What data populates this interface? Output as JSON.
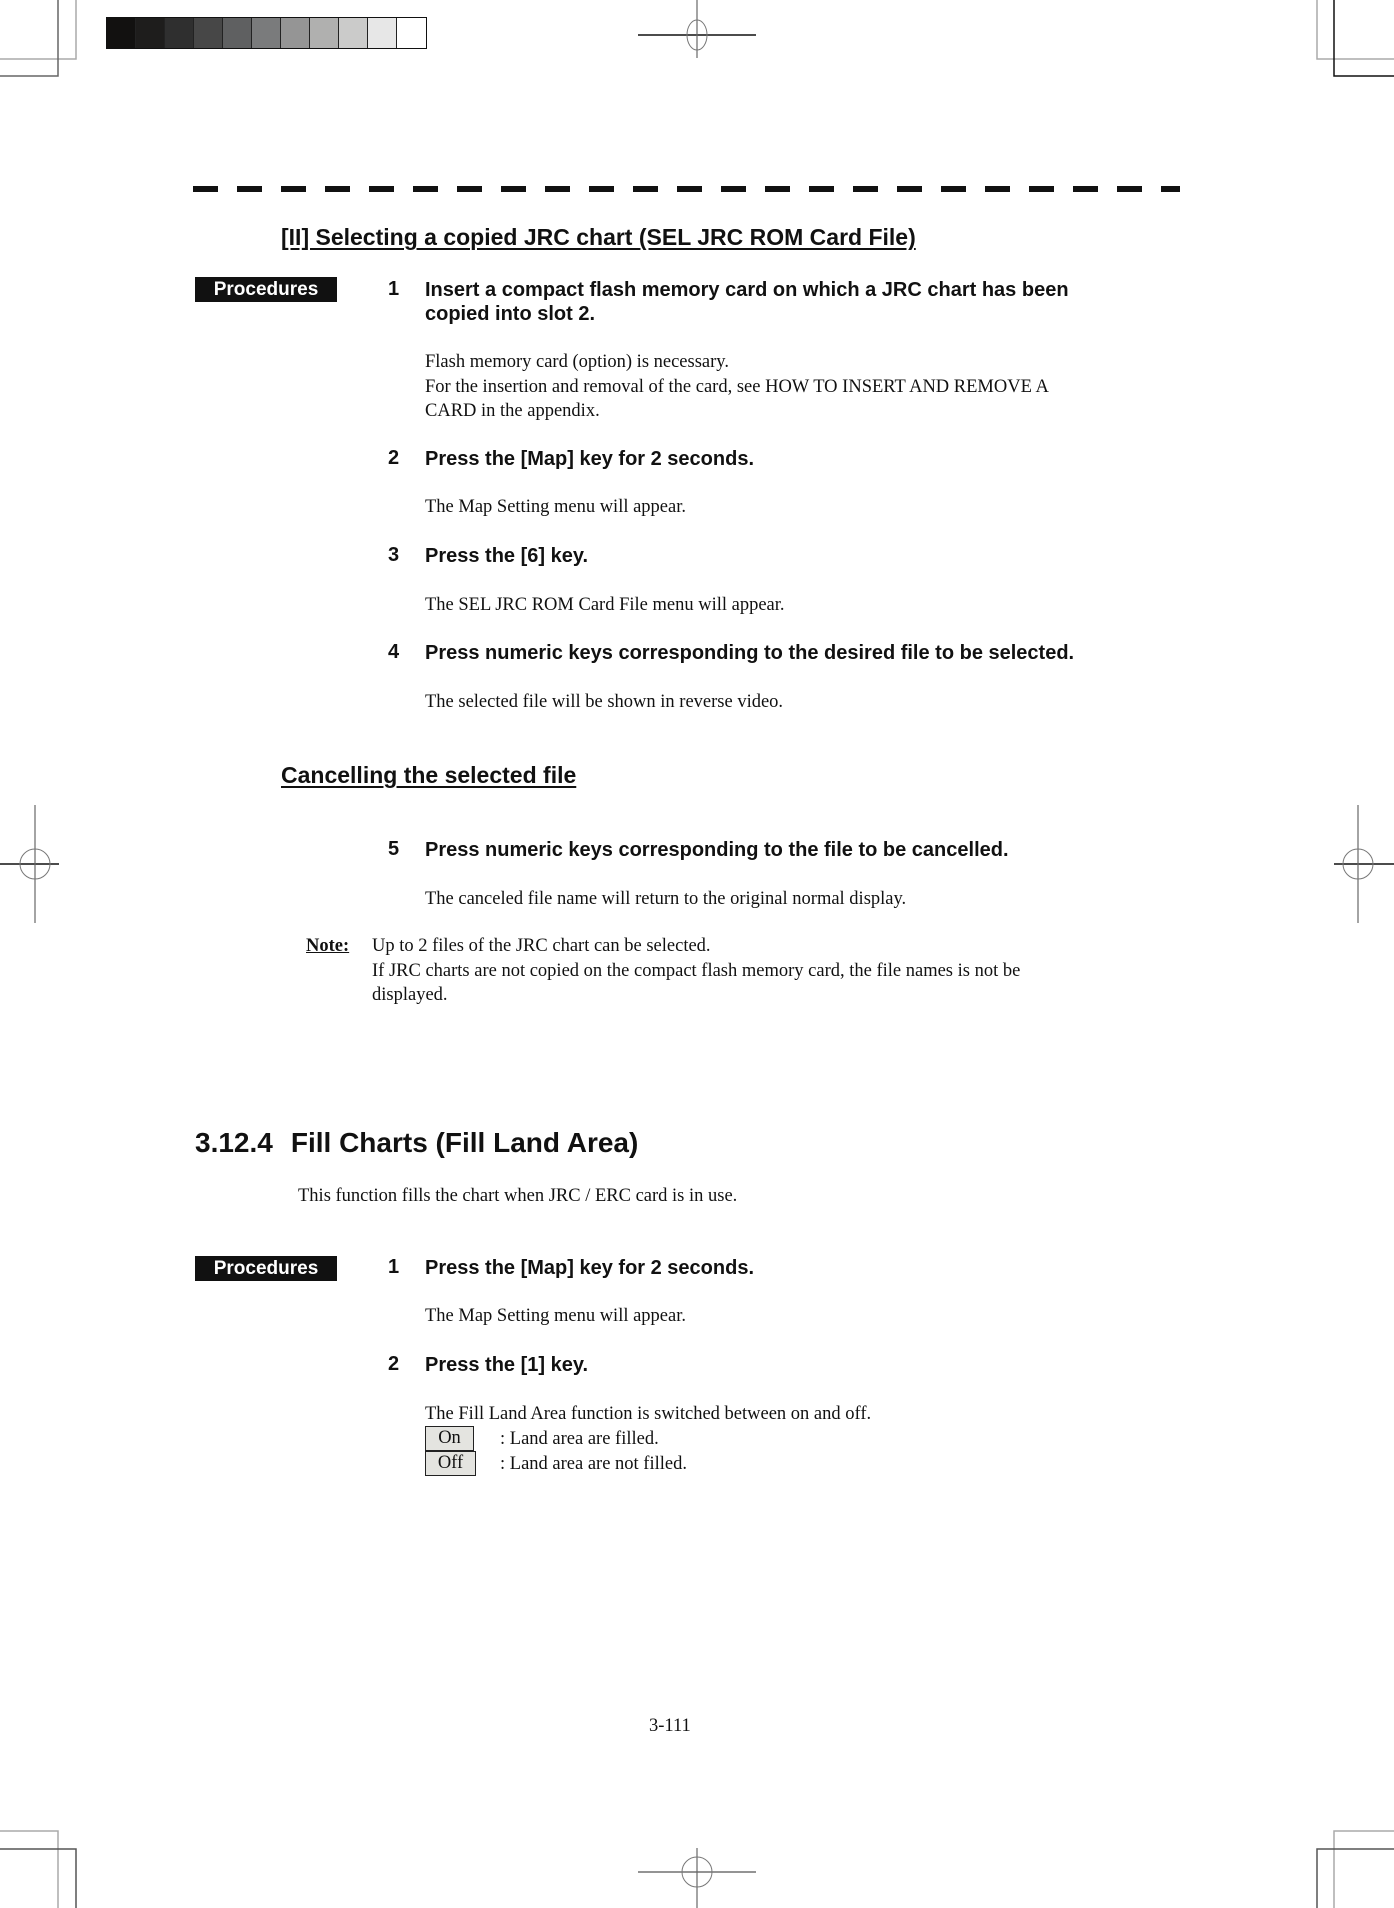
{
  "colors": {
    "text": "#111111",
    "badge_bg": "#111111",
    "badge_text": "#ffffff",
    "toggle_bg": "#e4e4e0"
  },
  "gray_scale_bar": [
    "#121110",
    "#1e1d1c",
    "#2f2f2f",
    "#474747",
    "#5f6061",
    "#7a7b7c",
    "#959595",
    "#b0b0af",
    "#cbcbca",
    "#e7e7e7",
    "#ffffff"
  ],
  "subsection": {
    "title": "[II]   Selecting a copied JRC chart (SEL JRC ROM Card File)",
    "procedures_label": "Procedures",
    "steps": [
      {
        "number": "1",
        "title_lines": [
          "Insert a compact flash memory card on which a JRC chart has been",
          "copied into slot 2."
        ],
        "body_lines": [
          "Flash memory card (option) is necessary.",
          "For the insertion and removal of the card, see HOW TO INSERT AND REMOVE A",
          "CARD in the appendix."
        ]
      },
      {
        "number": "2",
        "title_lines": [
          "Press the [Map] key for 2 seconds."
        ],
        "body_lines": [
          "The Map Setting menu will appear."
        ]
      },
      {
        "number": "3",
        "title_lines": [
          "Press the [6] key."
        ],
        "body_lines": [
          "The SEL JRC ROM Card File menu will appear."
        ]
      },
      {
        "number": "4",
        "title_lines": [
          "Press numeric keys corresponding to the desired file to be selected."
        ],
        "body_lines": [
          "The selected file will be shown in reverse video."
        ]
      }
    ],
    "cancel_heading": "Cancelling the selected file",
    "cancel_step": {
      "number": "5",
      "title": "Press numeric keys corresponding to the file to be cancelled.",
      "body": "The canceled file name will return to the original normal display."
    },
    "note": {
      "label": "Note:",
      "lines": [
        "Up to 2 files of the JRC chart can be selected.",
        "If JRC charts are not copied on the compact flash memory card, the file names is not be",
        "displayed."
      ]
    }
  },
  "section": {
    "number": "3.12.4",
    "title": "Fill Charts (Fill Land Area)",
    "intro": "This function fills the chart when JRC / ERC card is in use.",
    "procedures_label": "Procedures",
    "steps": [
      {
        "number": "1",
        "title": "Press the [Map] key for 2 seconds.",
        "body": "The Map Setting menu will appear."
      },
      {
        "number": "2",
        "title": "Press the [1] key.",
        "body": "The Fill Land Area function is switched between on and off."
      }
    ],
    "toggle_options": [
      {
        "label": "On",
        "description": ": Land area are filled."
      },
      {
        "label": "Off",
        "description": ": Land area are not filled."
      }
    ]
  },
  "page_number": "3-111"
}
